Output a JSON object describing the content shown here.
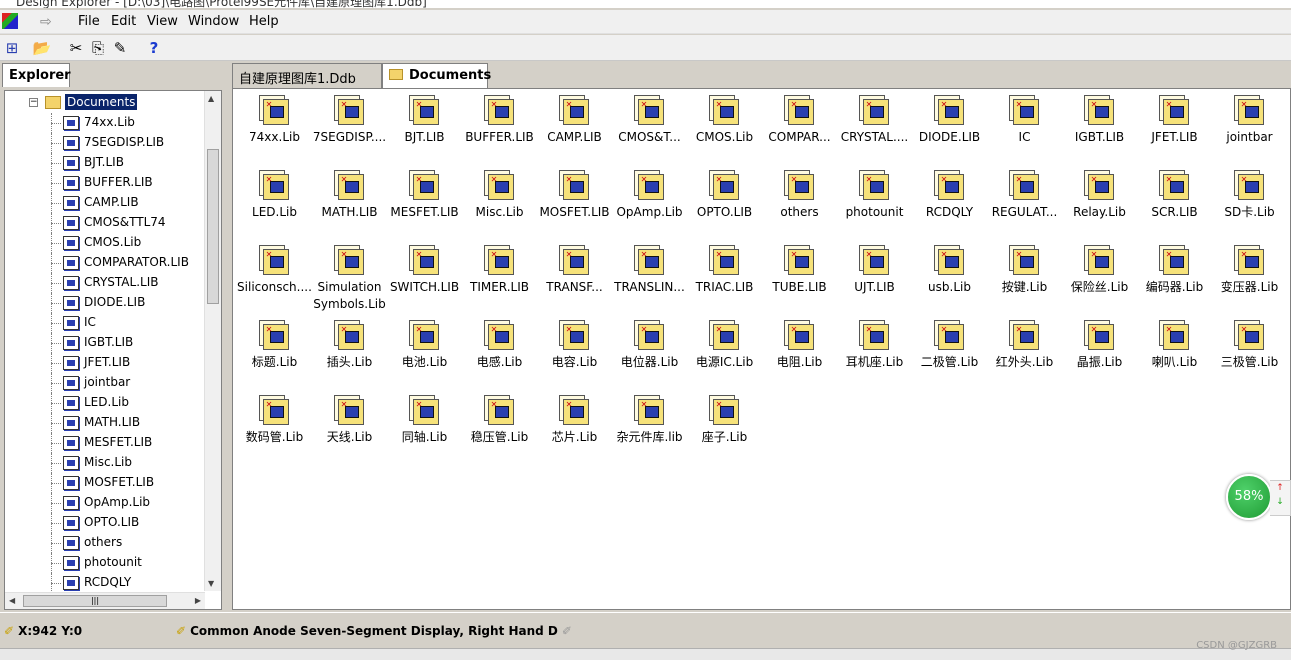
{
  "window": {
    "title": "Design Explorer - [D:\\03]\\电路图\\Protel99SE元件库\\自建原理图库1.Ddb]"
  },
  "menu": [
    "File",
    "Edit",
    "View",
    "Window",
    "Help"
  ],
  "toolbar": {
    "help_label": "?"
  },
  "explorer": {
    "tab_label": "Explorer",
    "root_label": "Documents",
    "items": [
      "74xx.Lib",
      "7SEGDISP.LIB",
      "BJT.LIB",
      "BUFFER.LIB",
      "CAMP.LIB",
      "CMOS&TTL74",
      "CMOS.Lib",
      "COMPARATOR.LIB",
      "CRYSTAL.LIB",
      "DIODE.LIB",
      "IC",
      "IGBT.LIB",
      "JFET.LIB",
      "jointbar",
      "LED.Lib",
      "MATH.LIB",
      "MESFET.LIB",
      "Misc.Lib",
      "MOSFET.LIB",
      "OpAmp.Lib",
      "OPTO.LIB",
      "others",
      "photounit",
      "RCDQLY"
    ]
  },
  "tabs": [
    {
      "label": "自建原理图库1.Ddb"
    },
    {
      "label": "Documents"
    }
  ],
  "files": [
    "74xx.Lib",
    "7SEGDISP....",
    "BJT.LIB",
    "BUFFER.LIB",
    "CAMP.LIB",
    "CMOS&T...",
    "CMOS.Lib",
    "COMPAR...",
    "CRYSTAL....",
    "DIODE.LIB",
    "IC",
    "IGBT.LIB",
    "JFET.LIB",
    "jointbar",
    "LED.Lib",
    "MATH.LIB",
    "MESFET.LIB",
    "Misc.Lib",
    "MOSFET.LIB",
    "OpAmp.Lib",
    "OPTO.LIB",
    "others",
    "photounit",
    "RCDQLY",
    "REGULAT...",
    "Relay.Lib",
    "SCR.LIB",
    "SD卡.Lib",
    "Siliconsch....",
    "Simulation Symbols.Lib",
    "SWITCH.LIB",
    "TIMER.LIB",
    "TRANSF...",
    "TRANSLIN...",
    "TRIAC.LIB",
    "TUBE.LIB",
    "UJT.LIB",
    "usb.Lib",
    "按键.Lib",
    "保险丝.Lib",
    "编码器.Lib",
    "变压器.Lib",
    "标题.Lib",
    "插头.Lib",
    "电池.Lib",
    "电感.Lib",
    "电容.Lib",
    "电位器.Lib",
    "电源IC.Lib",
    "电阻.Lib",
    "耳机座.Lib",
    "二极管.Lib",
    "红外头.Lib",
    "晶振.Lib",
    "喇叭.Lib",
    "三极管.Lib",
    "数码管.Lib",
    "天线.Lib",
    "同轴.Lib",
    "稳压管.Lib",
    "芯片.Lib",
    "杂元件库.lib",
    "座子.Lib"
  ],
  "status": {
    "coords": "X:942 Y:0",
    "message": "Common Anode Seven-Segment Display, Right Hand D"
  },
  "overlay": {
    "gauge_percent": "58%",
    "up_arrow": "↑",
    "down_arrow": "↓",
    "watermark": "CSDN @GJZGRB"
  }
}
